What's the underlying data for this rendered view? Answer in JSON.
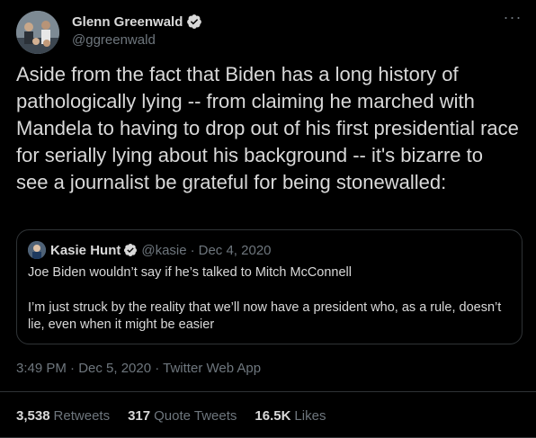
{
  "author": {
    "name": "Glenn Greenwald",
    "handle": "@ggreenwald"
  },
  "tweet_text": "Aside from the fact that Biden has a long history of pathologically lying -- from claiming he marched with Mandela to having to drop out of his first presidential race for serially lying about his background -- it's bizarre to see a journalist be grateful for being stonewalled:",
  "quoted": {
    "name": "Kasie Hunt",
    "handle": "@kasie",
    "separator": "·",
    "date": "Dec 4, 2020",
    "line1": "Joe Biden wouldn’t say if he’s talked to Mitch McConnell",
    "line2": "I’m just struck by the reality that we’ll now have a president who, as a rule, doesn’t lie, even when it might be easier"
  },
  "meta": "3:49 PM · Dec 5, 2020 · Twitter Web App",
  "stats": [
    {
      "value": "3,538",
      "label": "Retweets"
    },
    {
      "value": "317",
      "label": "Quote Tweets"
    },
    {
      "value": "16.5K",
      "label": "Likes"
    }
  ],
  "colors": {
    "background": "#000000",
    "text": "#d9d9d9",
    "secondary": "#6e767d",
    "verified": "#1d9bf0",
    "border": "#2f3336"
  },
  "icons": [
    "verified-badge-icon",
    "more-options-icon"
  ]
}
